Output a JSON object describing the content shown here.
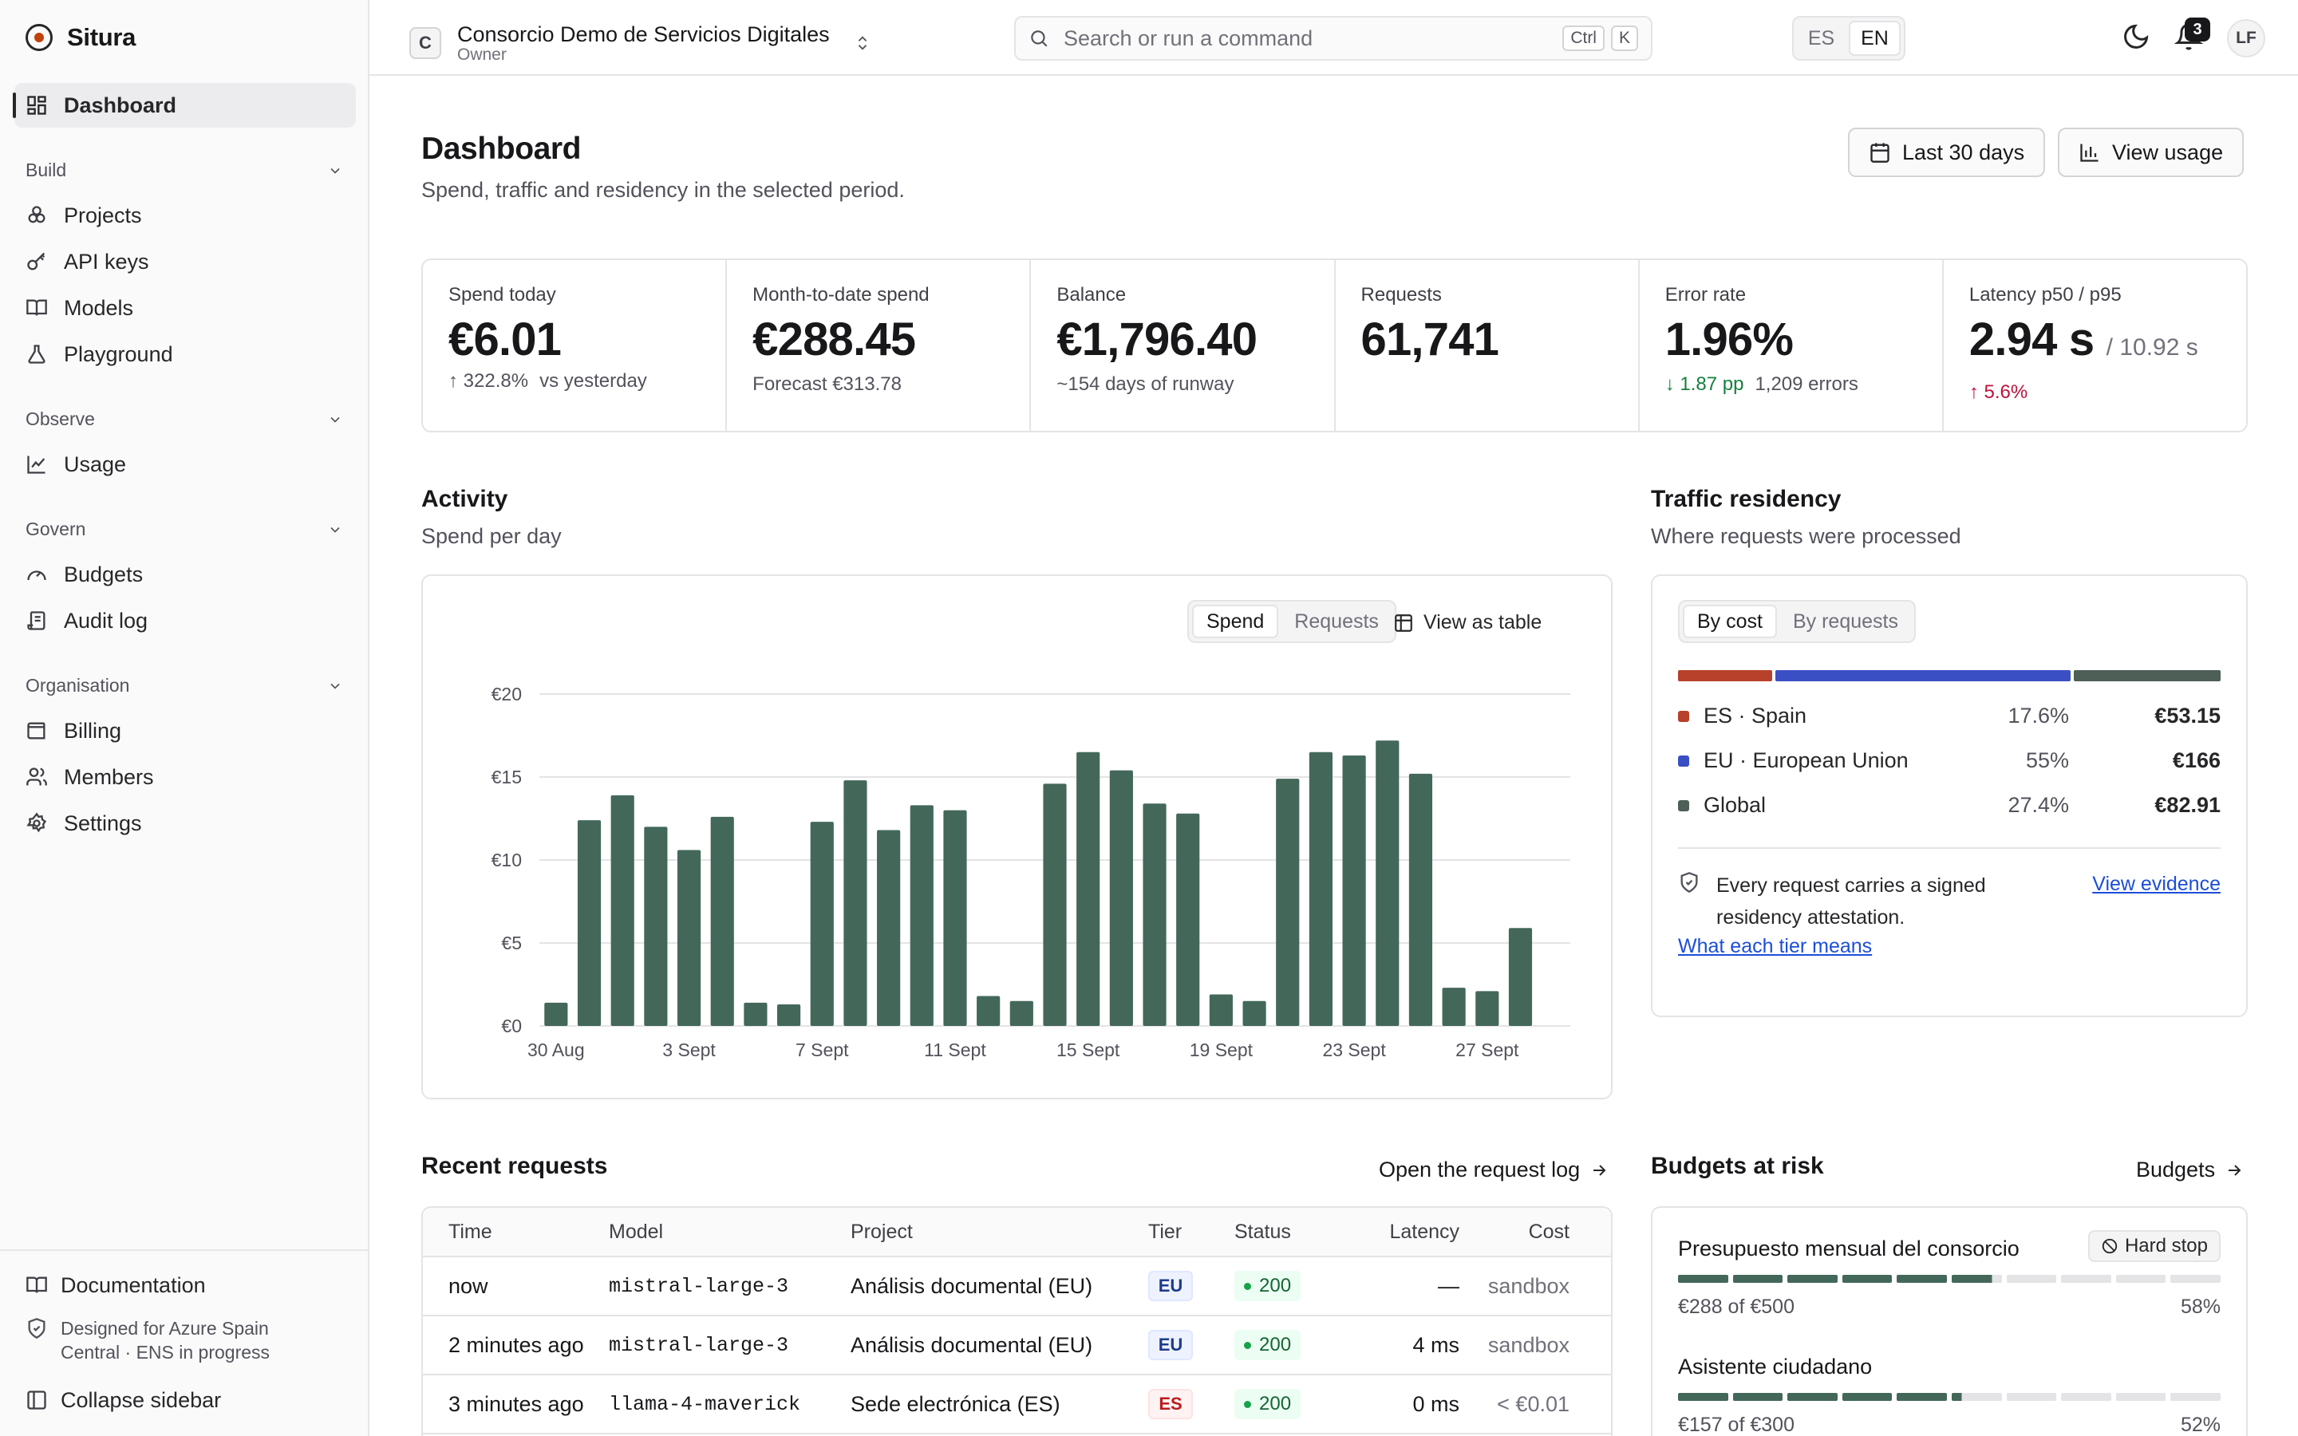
{
  "app": {
    "name": "Situra"
  },
  "sidebar": {
    "dashboard": "Dashboard",
    "groups": {
      "build": {
        "label": "Build",
        "items": [
          "Projects",
          "API keys",
          "Models",
          "Playground"
        ]
      },
      "observe": {
        "label": "Observe",
        "items": [
          "Usage"
        ]
      },
      "govern": {
        "label": "Govern",
        "items": [
          "Budgets",
          "Audit log"
        ]
      },
      "organisation": {
        "label": "Organisation",
        "items": [
          "Billing",
          "Members",
          "Settings"
        ]
      }
    },
    "footer": {
      "documentation": "Documentation",
      "designed_line1": "Designed for Azure Spain",
      "designed_line2": "Central · ENS in progress",
      "collapse": "Collapse sidebar"
    }
  },
  "topbar": {
    "org_initial": "C",
    "org_name": "Consorcio Demo de Servicios Digitales",
    "org_role": "Owner",
    "search_placeholder": "Search or run a command",
    "kbd_ctrl": "Ctrl",
    "kbd_k": "K",
    "lang_es": "ES",
    "lang_en": "EN",
    "lang_selected": "EN",
    "notifications_count": "3",
    "avatar_initials": "LF"
  },
  "header": {
    "title": "Dashboard",
    "subtitle": "Spend, traffic and residency in the selected period.",
    "range_button": "Last 30 days",
    "usage_button": "View usage"
  },
  "kpis": {
    "spend_today": {
      "label": "Spend today",
      "value": "€6.01",
      "delta": "322.8%",
      "delta_note": "vs yesterday"
    },
    "mtd": {
      "label": "Month-to-date spend",
      "value": "€288.45",
      "note": "Forecast €313.78"
    },
    "balance": {
      "label": "Balance",
      "value": "€1,796.40",
      "note": "~154 days of runway"
    },
    "requests": {
      "label": "Requests",
      "value": "61,741"
    },
    "error_rate": {
      "label": "Error rate",
      "value": "1.96%",
      "delta": "1.87 pp",
      "note": "1,209 errors"
    },
    "latency": {
      "label": "Latency p50 / p95",
      "value": "2.94 s",
      "p95": "/ 10.92 s",
      "delta": "5.6%"
    }
  },
  "activity": {
    "title": "Activity",
    "subtitle": "Spend per day",
    "seg_spend": "Spend",
    "seg_requests": "Requests",
    "seg_selected": "Spend",
    "view_table": "View as table"
  },
  "chart_data": {
    "type": "bar",
    "title": "",
    "xlabel": "",
    "ylabel": "",
    "ylim": [
      0,
      20
    ],
    "yticks": [
      "€0",
      "€5",
      "€10",
      "€15",
      "€20"
    ],
    "xtick_labels": [
      "30 Aug",
      "3 Sept",
      "7 Sept",
      "11 Sept",
      "15 Sept",
      "19 Sept",
      "23 Sept",
      "27 Sept"
    ],
    "xtick_every": 4,
    "categories": [
      "30 Aug",
      "31 Aug",
      "1 Sept",
      "2 Sept",
      "3 Sept",
      "4 Sept",
      "5 Sept",
      "6 Sept",
      "7 Sept",
      "8 Sept",
      "9 Sept",
      "10 Sept",
      "11 Sept",
      "12 Sept",
      "13 Sept",
      "14 Sept",
      "15 Sept",
      "16 Sept",
      "17 Sept",
      "18 Sept",
      "19 Sept",
      "20 Sept",
      "21 Sept",
      "22 Sept",
      "23 Sept",
      "24 Sept",
      "25 Sept",
      "26 Sept",
      "27 Sept",
      "28 Sept",
      "29 Sept"
    ],
    "values": [
      1.4,
      12.4,
      13.9,
      12.0,
      10.6,
      12.6,
      1.4,
      1.3,
      12.3,
      14.8,
      11.8,
      13.3,
      13.0,
      1.8,
      1.5,
      14.6,
      16.5,
      15.4,
      13.4,
      12.8,
      1.9,
      1.5,
      14.9,
      16.5,
      16.3,
      17.2,
      15.2,
      2.3,
      2.1,
      5.9
    ],
    "grid": true,
    "bar_color": "#43685a"
  },
  "residency": {
    "title": "Traffic residency",
    "subtitle": "Where requests were processed",
    "seg_cost": "By cost",
    "seg_requests": "By requests",
    "seg_selected": "By cost",
    "rows": [
      {
        "name": "ES · Spain",
        "pct": "17.6%",
        "amount": "€53.15",
        "share": 0.176,
        "color": "#b7412a"
      },
      {
        "name": "EU · European Union",
        "pct": "55%",
        "amount": "€166",
        "share": 0.55,
        "color": "#3b4fc4"
      },
      {
        "name": "Global",
        "pct": "27.4%",
        "amount": "€82.91",
        "share": 0.274,
        "color": "#4d5f57"
      }
    ],
    "attestation_line1": "Every request carries a signed",
    "attestation_line2": "residency attestation.",
    "view_evidence": "View evidence",
    "tier_link": "What each tier means"
  },
  "recent": {
    "title": "Recent requests",
    "open_log": "Open the request log",
    "columns": {
      "time": "Time",
      "model": "Model",
      "project": "Project",
      "tier": "Tier",
      "status": "Status",
      "latency": "Latency",
      "cost": "Cost"
    },
    "rows": [
      {
        "time": "now",
        "model": "mistral-large-3",
        "project": "Análisis documental (EU)",
        "tier": "EU",
        "status": "200",
        "latency": "—",
        "cost": "sandbox"
      },
      {
        "time": "2 minutes ago",
        "model": "mistral-large-3",
        "project": "Análisis documental (EU)",
        "tier": "EU",
        "status": "200",
        "latency": "4 ms",
        "cost": "sandbox"
      },
      {
        "time": "3 minutes ago",
        "model": "llama-4-maverick",
        "project": "Sede electrónica (ES)",
        "tier": "ES",
        "status": "200",
        "latency": "0 ms",
        "cost": "< €0.01"
      }
    ]
  },
  "budgets": {
    "title": "Budgets at risk",
    "link": "Budgets",
    "items": [
      {
        "name": "Presupuesto mensual del consorcio",
        "badge": "Hard stop",
        "used": "€288 of €500",
        "pct": "58%",
        "fraction": 0.58
      },
      {
        "name": "Asistente ciudadano",
        "used": "€157 of €300",
        "pct": "52%",
        "fraction": 0.52
      }
    ]
  },
  "colors": {
    "accent_green": "#43685a",
    "danger": "#be123c",
    "success": "#15803d",
    "link": "#1d4ed8"
  }
}
